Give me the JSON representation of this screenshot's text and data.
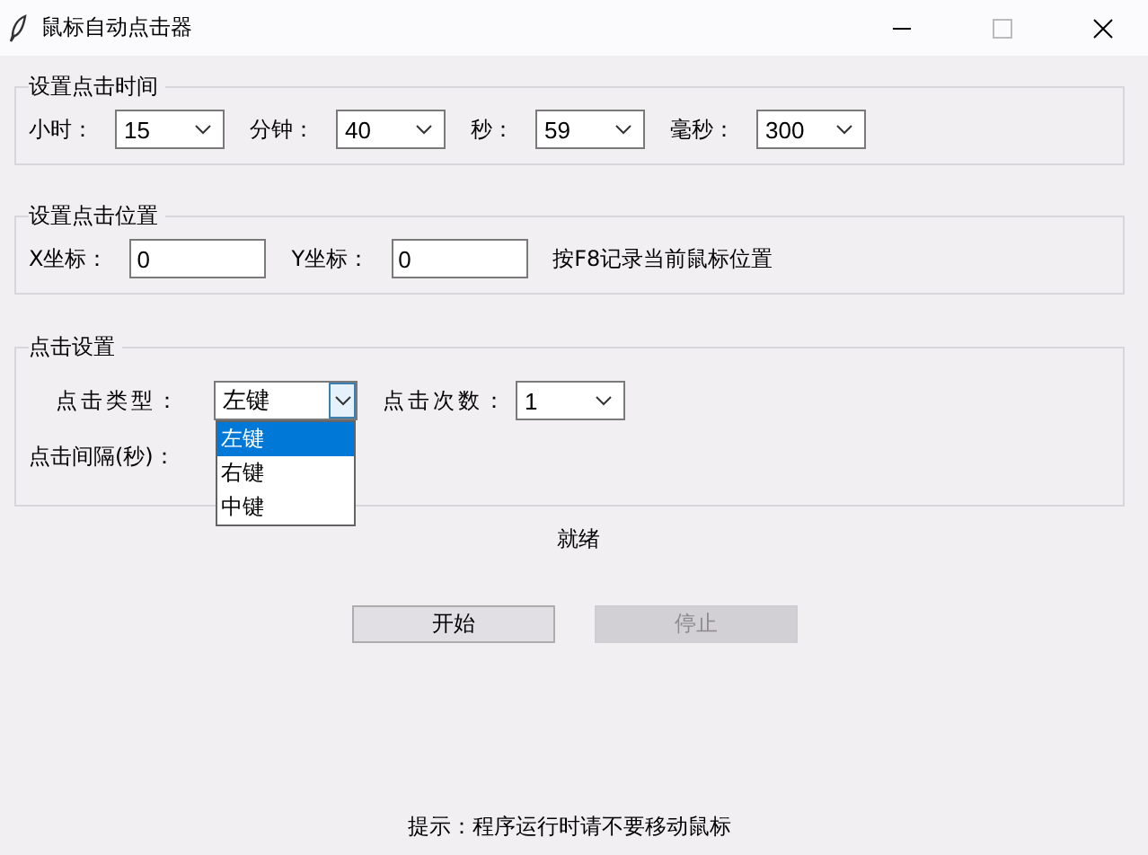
{
  "window": {
    "title": "鼠标自动点击器"
  },
  "time_group": {
    "title": "设置点击时间",
    "fields": [
      {
        "label": "小时：",
        "value": "15"
      },
      {
        "label": "分钟：",
        "value": "40"
      },
      {
        "label": "秒：",
        "value": "59"
      },
      {
        "label": "毫秒：",
        "value": "300"
      }
    ]
  },
  "position_group": {
    "title": "设置点击位置",
    "fields": [
      {
        "label": "X坐标：",
        "value": "0"
      },
      {
        "label": "Y坐标：",
        "value": "0"
      }
    ],
    "hint": "按F8记录当前鼠标位置"
  },
  "click_group": {
    "title": "点击设置",
    "type_label": "点击类型：",
    "type_value": "左键",
    "count_label": "点击次数：",
    "count_value": "1",
    "interval_label": "点击间隔(秒)：",
    "type_options": [
      {
        "label": "左键",
        "selected": true
      },
      {
        "label": "右键",
        "selected": false
      },
      {
        "label": "中键",
        "selected": false
      }
    ]
  },
  "status": "就绪",
  "buttons": [
    {
      "label": "开始",
      "disabled": false
    },
    {
      "label": "停止",
      "disabled": true
    }
  ],
  "tip": "提示：程序运行时请不要移动鼠标"
}
